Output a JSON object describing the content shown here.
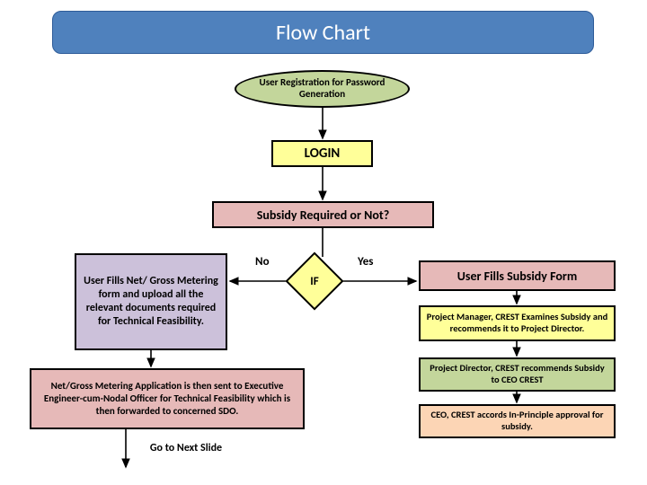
{
  "title": "Flow Chart",
  "nodes": {
    "start": "User Registration for Password Generation",
    "login": "LOGIN",
    "decision_subsidy": "Subsidy Required or Not?",
    "no_branch": "User Fills Net/ Gross Metering form and upload all the relevant documents required for Technical Feasibility.",
    "if": "IF",
    "no_label": "No",
    "yes_label": "Yes",
    "yes_branch": "User Fills Subsidy Form",
    "pm_crest": "Project Manager, CREST Examines Subsidy and recommends it to Project Director.",
    "pd_crest": "Project Director, CREST recommends Subsidy to CEO CREST",
    "ceo_crest": "CEO, CREST accords In-Principle approval for subsidy.",
    "netgross": "Net/Gross Metering Application is then sent to Executive Engineer-cum-Nodal Officer for Technical Feasibility which is then forwarded to concerned SDO.",
    "goto": "Go to Next Slide"
  }
}
